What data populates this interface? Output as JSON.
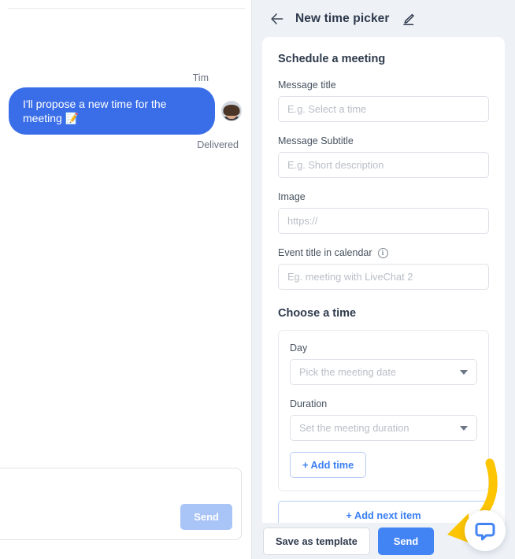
{
  "chat": {
    "sender_name": "Tim",
    "message_text": "I'll propose a new time for the meeting 📝",
    "status": "Delivered",
    "composer_send_label": "Send",
    "composer_placeholder": ""
  },
  "panel": {
    "title": "New time picker",
    "back_icon": "arrow-left-icon",
    "edit_icon": "pencil-edit-icon"
  },
  "form": {
    "section_title": "Schedule a meeting",
    "fields": [
      {
        "label": "Message title",
        "placeholder": "E.g. Select a time",
        "value": ""
      },
      {
        "label": "Message Subtitle",
        "placeholder": "E.g. Short description",
        "value": ""
      },
      {
        "label": "Image",
        "placeholder": "https://",
        "value": ""
      },
      {
        "label": "Event title in calendar",
        "placeholder": "Eg. meeting with LiveChat 2",
        "value": "",
        "info_icon": "info-circle-icon"
      }
    ],
    "time_section_title": "Choose a time",
    "day": {
      "label": "Day",
      "placeholder": "Pick the meeting date",
      "value": ""
    },
    "duration": {
      "label": "Duration",
      "placeholder": "Set the meeting duration",
      "value": ""
    },
    "add_time_label": "+ Add time",
    "add_next_item_label": "+ Add next item"
  },
  "footer": {
    "save_label": "Save as template",
    "send_label": "Send"
  },
  "widget": {
    "icon": "livechat-speech-bubble-icon"
  },
  "colors": {
    "accent_blue": "#4384f5",
    "bubble_blue": "#3a6ee8",
    "panel_bg": "#eef2f7",
    "arrow_yellow": "#fdc500",
    "disabled_send": "#a9c4f7"
  }
}
